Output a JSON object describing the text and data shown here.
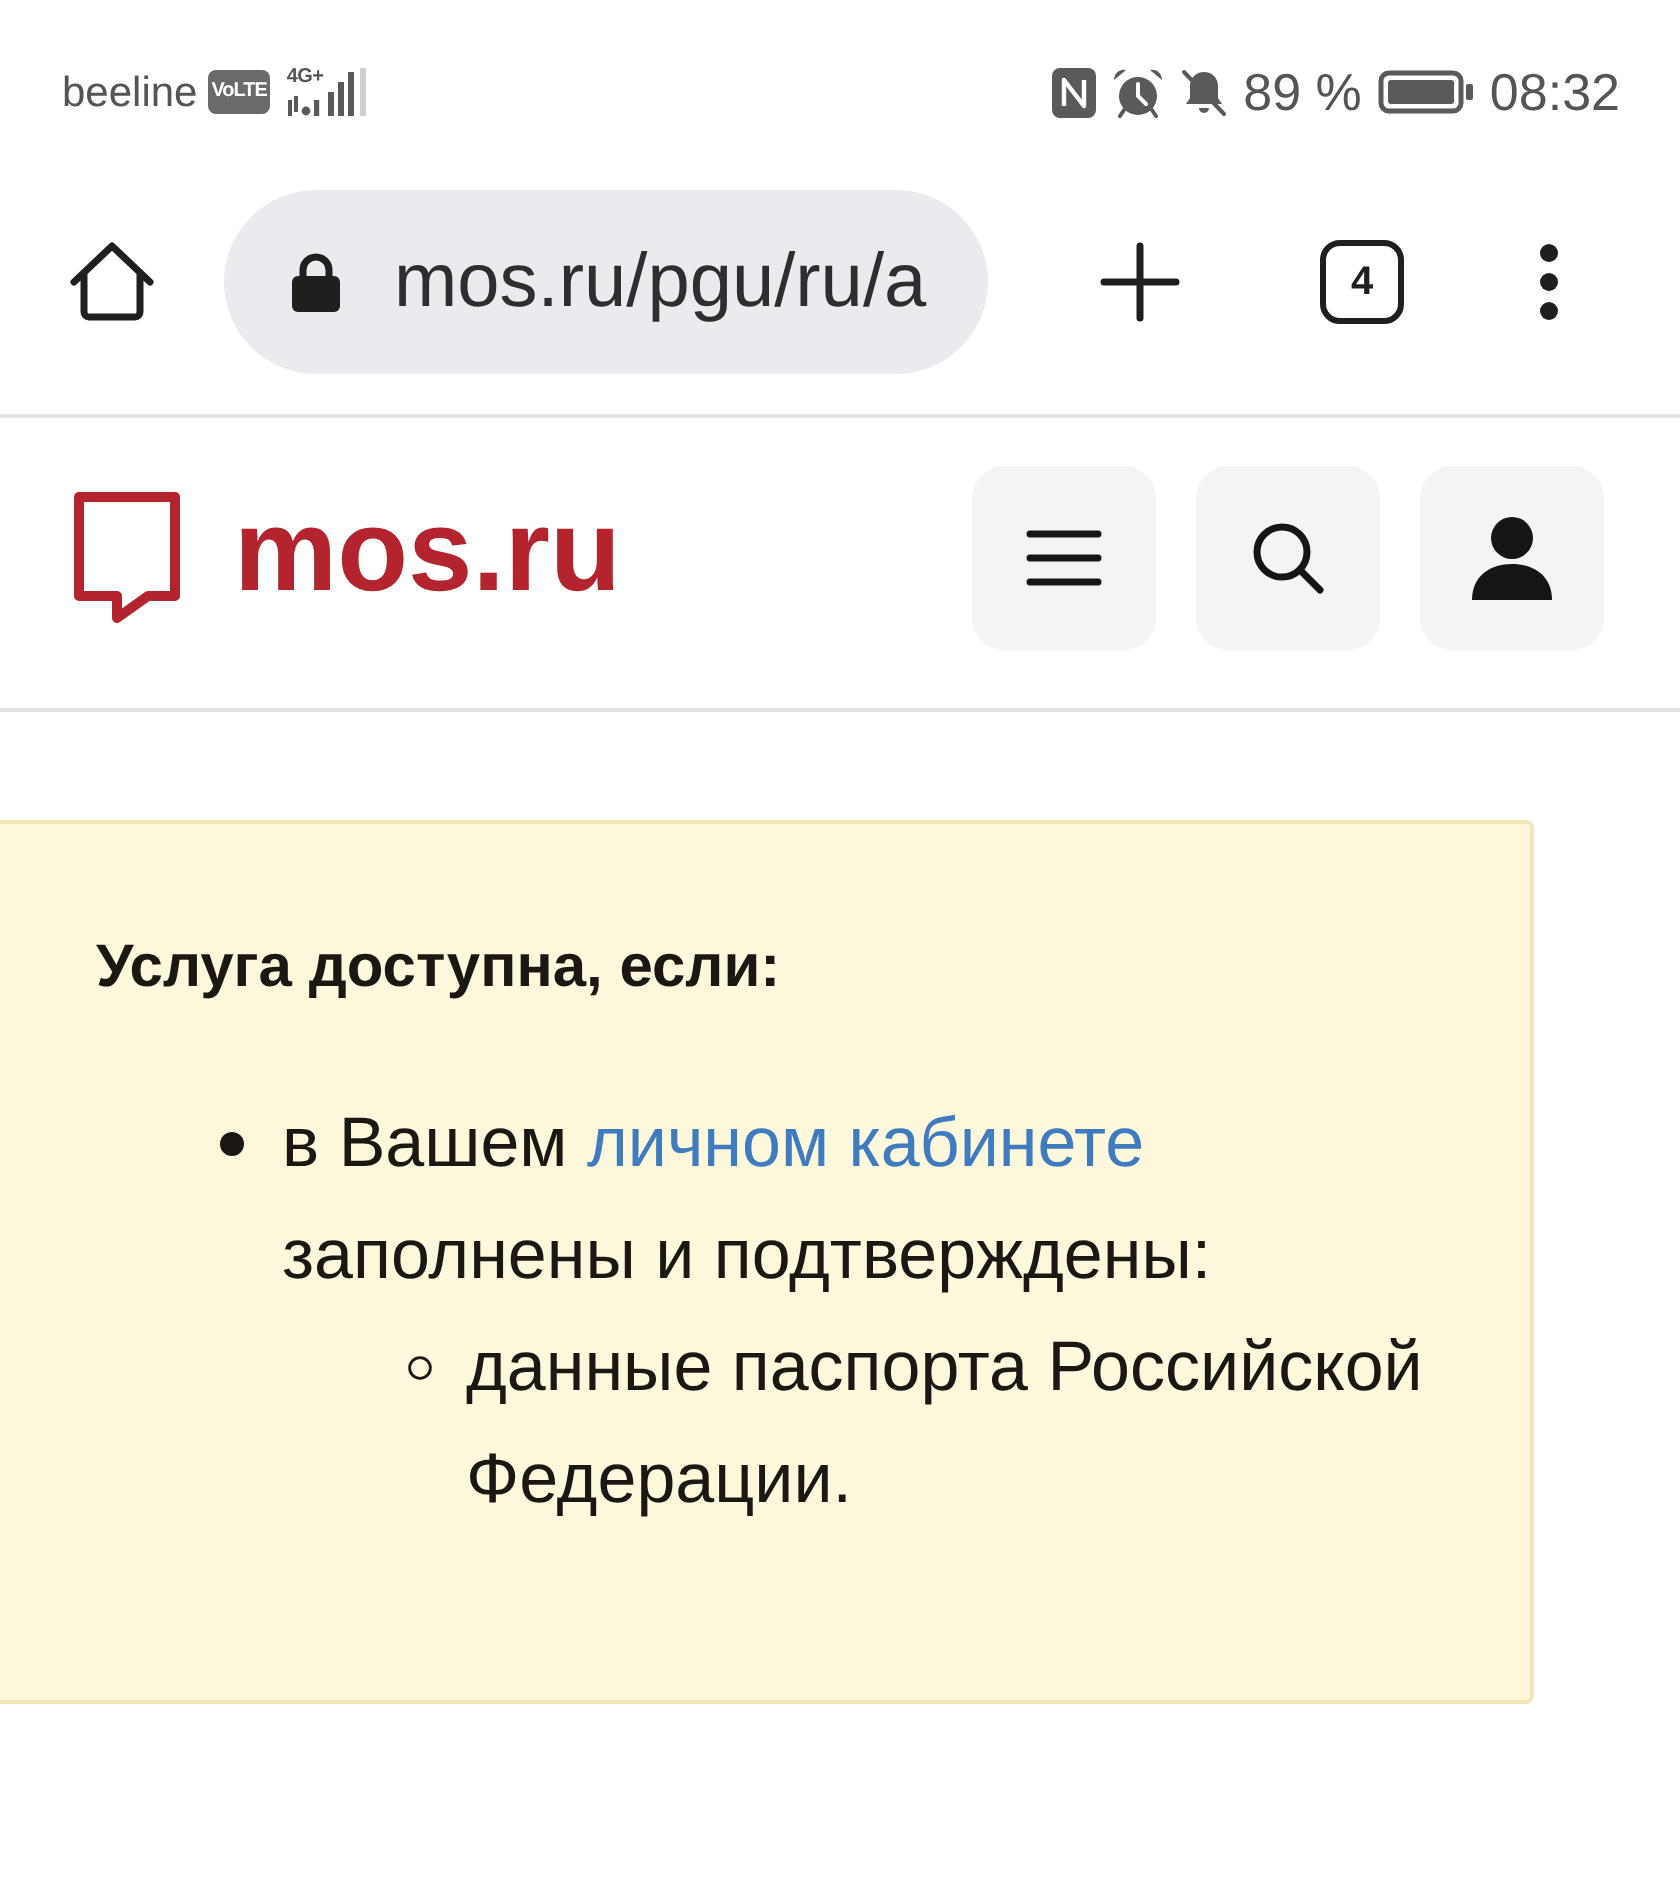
{
  "status_bar": {
    "carrier": "beeline",
    "volte": "VoLTE",
    "network_type": "4G+",
    "battery": "89 %",
    "time": "08:32"
  },
  "browser_toolbar": {
    "url": "mos.ru/pgu/ru/a",
    "tab_count": "4"
  },
  "site_header": {
    "logo_text": "mos.ru"
  },
  "notice": {
    "title": "Услуга доступна, если:",
    "items": [
      {
        "text": "в Вашем ",
        "link": "личном кабинете",
        "text_after": " заполнены и подтверждены:",
        "children": [
          {
            "text": "данные паспорта Российской Федерации."
          }
        ]
      }
    ]
  }
}
